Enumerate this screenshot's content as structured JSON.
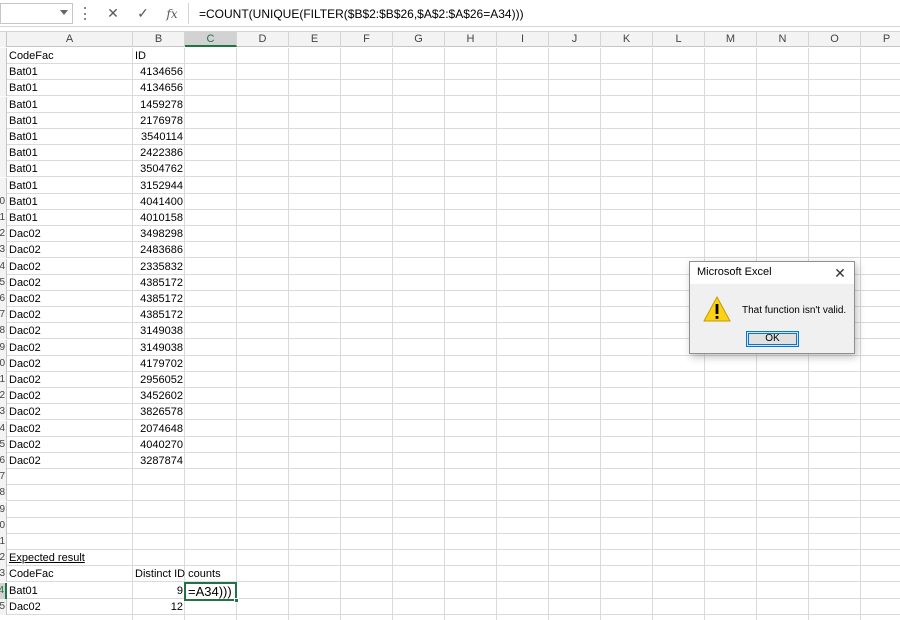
{
  "formula_bar": {
    "name_box": "",
    "cancel_icon": "✕",
    "enter_icon": "✓",
    "fx_label": "fx",
    "formula": "=COUNT(UNIQUE(FILTER($B$2:$B$26,$A$2:$A$26=A34)))"
  },
  "columns": [
    "A",
    "B",
    "C",
    "D",
    "E",
    "F",
    "G",
    "H",
    "I",
    "J",
    "K",
    "L",
    "M",
    "N",
    "O",
    "P"
  ],
  "active_column": "C",
  "row_headers": [
    "",
    "",
    "",
    "",
    "",
    "",
    "",
    "",
    "",
    "0",
    "1",
    "2",
    "3",
    "4",
    "5",
    "6",
    "7",
    "8",
    "9",
    "0",
    "1",
    "2",
    "3",
    "4",
    "5",
    "6",
    "7",
    "8",
    "9",
    "0",
    "1",
    "2",
    "3",
    "4",
    "5"
  ],
  "active_row_label": "4",
  "headers": {
    "codefac": "CodeFac",
    "id": "ID"
  },
  "data_rows": [
    {
      "code": "Bat01",
      "id": "4134656"
    },
    {
      "code": "Bat01",
      "id": "4134656"
    },
    {
      "code": "Bat01",
      "id": "1459278"
    },
    {
      "code": "Bat01",
      "id": "2176978"
    },
    {
      "code": "Bat01",
      "id": "3540114"
    },
    {
      "code": "Bat01",
      "id": "2422386"
    },
    {
      "code": "Bat01",
      "id": "3504762"
    },
    {
      "code": "Bat01",
      "id": "3152944"
    },
    {
      "code": "Bat01",
      "id": "4041400"
    },
    {
      "code": "Bat01",
      "id": "4010158"
    },
    {
      "code": "Dac02",
      "id": "3498298"
    },
    {
      "code": "Dac02",
      "id": "2483686"
    },
    {
      "code": "Dac02",
      "id": "2335832"
    },
    {
      "code": "Dac02",
      "id": "4385172"
    },
    {
      "code": "Dac02",
      "id": "4385172"
    },
    {
      "code": "Dac02",
      "id": "4385172"
    },
    {
      "code": "Dac02",
      "id": "3149038"
    },
    {
      "code": "Dac02",
      "id": "3149038"
    },
    {
      "code": "Dac02",
      "id": "4179702"
    },
    {
      "code": "Dac02",
      "id": "2956052"
    },
    {
      "code": "Dac02",
      "id": "3452602"
    },
    {
      "code": "Dac02",
      "id": "3826578"
    },
    {
      "code": "Dac02",
      "id": "2074648"
    },
    {
      "code": "Dac02",
      "id": "4040270"
    },
    {
      "code": "Dac02",
      "id": "3287874"
    }
  ],
  "expected": {
    "title": "Expected result",
    "codefac_header": "CodeFac",
    "counts_header": "Distinct ID counts",
    "rows": [
      {
        "code": "Bat01",
        "count": "9"
      },
      {
        "code": "Dac02",
        "count": "12"
      }
    ],
    "editing_text": "=A34)))"
  },
  "dialog": {
    "title": "Microsoft Excel",
    "close_icon": "✕",
    "warning_icon": "warning-icon",
    "message": "That function isn't valid.",
    "ok_label": "OK"
  },
  "colors": {
    "accent": "#217346",
    "dialog_focus": "#0078d7",
    "warning": "#fcd116"
  }
}
